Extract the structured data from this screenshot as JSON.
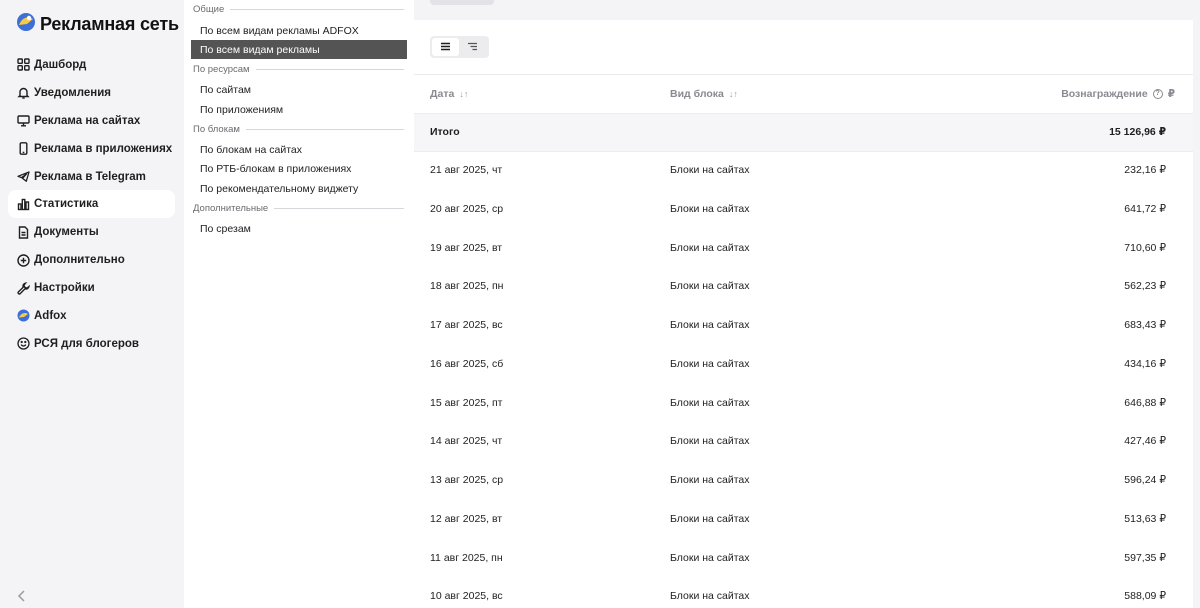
{
  "brand": {
    "name": "Рекламная сеть",
    "colors": {
      "blue": "#3d6fd8",
      "yellow": "#f7c948",
      "dark": "#1f1f1f"
    }
  },
  "sidebar": {
    "items": [
      {
        "label": "Дашборд",
        "icon": "dashboard-icon",
        "active": false
      },
      {
        "label": "Уведомления",
        "icon": "bell-icon",
        "active": false
      },
      {
        "label": "Реклама на сайтах",
        "icon": "monitor-icon",
        "active": false
      },
      {
        "label": "Реклама в приложениях",
        "icon": "phone-icon",
        "active": false
      },
      {
        "label": "Реклама в Telegram",
        "icon": "telegram-icon",
        "active": false
      },
      {
        "label": "Статистика",
        "icon": "chart-icon",
        "active": true
      },
      {
        "label": "Документы",
        "icon": "document-icon",
        "active": false
      },
      {
        "label": "Дополнительно",
        "icon": "plus-circle-icon",
        "active": false
      },
      {
        "label": "Настройки",
        "icon": "wrench-icon",
        "active": false
      },
      {
        "label": "Adfox",
        "icon": "adfox-icon",
        "active": false
      },
      {
        "label": "РСЯ для блогеров",
        "icon": "smile-icon",
        "active": false
      }
    ],
    "collapse_icon": "chevron-left-icon"
  },
  "menu": {
    "groups": {
      "general": "Общие",
      "resources": "По ресурсам",
      "blocks": "По блокам",
      "extra": "Дополнительные"
    },
    "items": {
      "adfox_all": "По всем видам рекламы ADFOX",
      "all_ads": "По всем видам рекламы",
      "by_sites": "По сайтам",
      "by_apps": "По приложениям",
      "by_site_blocks": "По блокам на сайтах",
      "by_rtb_app_blocks": "По РТБ-блокам в приложениях",
      "by_widget": "По рекомендательному виджету",
      "by_slices": "По срезам"
    },
    "selected": "all_ads"
  },
  "table": {
    "headers": {
      "date": "Дата",
      "block_type": "Вид блока",
      "revenue": "Вознаграждение"
    },
    "sort_icon": "sort-icon",
    "help_icon": "help-icon",
    "total": {
      "label": "Итого",
      "revenue": "15 126,96 ₽"
    },
    "rows": [
      {
        "date": "21 авг 2025, чт",
        "type": "Блоки на сайтах",
        "revenue": "232,16 ₽"
      },
      {
        "date": "20 авг 2025, ср",
        "type": "Блоки на сайтах",
        "revenue": "641,72 ₽"
      },
      {
        "date": "19 авг 2025, вт",
        "type": "Блоки на сайтах",
        "revenue": "710,60 ₽"
      },
      {
        "date": "18 авг 2025, пн",
        "type": "Блоки на сайтах",
        "revenue": "562,23 ₽"
      },
      {
        "date": "17 авг 2025, вс",
        "type": "Блоки на сайтах",
        "revenue": "683,43 ₽"
      },
      {
        "date": "16 авг 2025, сб",
        "type": "Блоки на сайтах",
        "revenue": "434,16 ₽"
      },
      {
        "date": "15 авг 2025, пт",
        "type": "Блоки на сайтах",
        "revenue": "646,88 ₽"
      },
      {
        "date": "14 авг 2025, чт",
        "type": "Блоки на сайтах",
        "revenue": "427,46 ₽"
      },
      {
        "date": "13 авг 2025, ср",
        "type": "Блоки на сайтах",
        "revenue": "596,24 ₽"
      },
      {
        "date": "12 авг 2025, вт",
        "type": "Блоки на сайтах",
        "revenue": "513,63 ₽"
      },
      {
        "date": "11 авг 2025, пн",
        "type": "Блоки на сайтах",
        "revenue": "597,35 ₽"
      },
      {
        "date": "10 авг 2025, вс",
        "type": "Блоки на сайтах",
        "revenue": "588,09 ₽"
      }
    ]
  },
  "view_toggle": {
    "table": "list-view-icon",
    "tree": "tree-view-icon",
    "selected": "table"
  }
}
